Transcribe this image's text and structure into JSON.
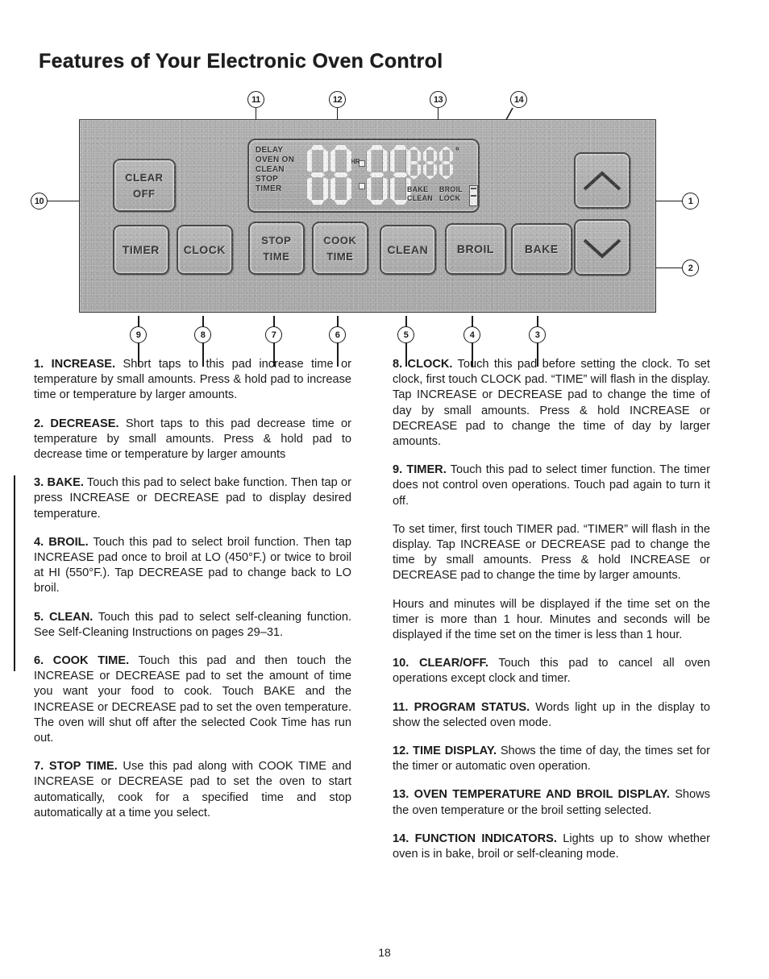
{
  "document": {
    "title": "Features of Your Electronic Oven Control",
    "page_number": "18"
  },
  "control_panel": {
    "display": {
      "program_status_labels": [
        "DELAY",
        "OVEN ON",
        "CLEAN",
        "STOP",
        "TIMER"
      ],
      "hr_marker": "HR",
      "degree_symbol": "°",
      "function_indicators": [
        [
          "BAKE",
          "CLEAN"
        ],
        [
          "BROIL",
          "LOCK"
        ]
      ]
    },
    "pads": {
      "clear_off_line1": "CLEAR",
      "clear_off_line2": "OFF",
      "timer": "TIMER",
      "clock": "CLOCK",
      "stop_time_line1": "STOP",
      "stop_time_line2": "TIME",
      "cook_time_line1": "COOK",
      "cook_time_line2": "TIME",
      "clean": "CLEAN",
      "broil": "BROIL",
      "bake": "BAKE",
      "increase_icon": "chevron-up-icon",
      "decrease_icon": "chevron-down-icon"
    },
    "callouts": {
      "c1": "1",
      "c2": "2",
      "c3": "3",
      "c4": "4",
      "c5": "5",
      "c6": "6",
      "c7": "7",
      "c8": "8",
      "c9": "9",
      "c10": "10",
      "c11": "11",
      "c12": "12",
      "c13": "13",
      "c14": "14"
    }
  },
  "left_column": {
    "p1_label": "1. INCREASE.",
    "p1_text": " Short taps to this pad increase time or temperature by small amounts. Press & hold pad to increase time or temperature by larger amounts.",
    "p2_label": "2. DECREASE.",
    "p2_text": " Short taps to this pad decrease time or temperature by small amounts. Press & hold pad to decrease time or temperature by larger amounts",
    "p3_label": "3. BAKE.",
    "p3_text": " Touch this pad to select bake function. Then tap or press INCREASE or DECREASE pad to display desired temperature.",
    "p4_label": "4. BROIL.",
    "p4_text": " Touch this pad to select broil function. Then tap INCREASE pad once to broil at LO (450°F.) or twice to broil at HI (550°F.). Tap DECREASE pad to change back to LO broil.",
    "p5_label": "5. CLEAN.",
    "p5_text": " Touch this pad to select self-cleaning function. See Self-Cleaning Instructions on pages 29–31.",
    "p6_label": "6. COOK TIME.",
    "p6_text": " Touch this pad and then touch the INCREASE or DECREASE pad to set the amount of time you want your food to cook. Touch BAKE and the INCREASE or DECREASE pad to set the oven temperature. The oven will shut off after the selected Cook Time has run out.",
    "p7_label": "7. STOP TIME.",
    "p7_text": " Use this pad along with COOK TIME and INCREASE or DECREASE pad to set the oven to start automatically, cook for a specified time and stop automatically at a time you select."
  },
  "right_column": {
    "p8_label": "8. CLOCK.",
    "p8_text": " Touch this pad before setting the clock. To set clock, first touch CLOCK pad. “TIME” will flash in the display. Tap INCREASE or DECREASE pad to change the time of day by small amounts. Press & hold INCREASE or DECREASE pad to change the time of day by larger amounts.",
    "p9_label": "9. TIMER.",
    "p9_text": " Touch this pad to select timer function. The timer does not control oven operations. Touch pad again to turn it off.",
    "p9b_text": "To set timer, first touch TIMER pad. “TIMER” will flash in the display. Tap INCREASE or DECREASE pad to change the time by small amounts. Press & hold INCREASE or DECREASE pad to change the time by larger amounts.",
    "p9c_text": "Hours and minutes will be displayed if the time set on the timer is more than 1 hour. Minutes and seconds will be displayed if the time set on the timer is less than 1 hour.",
    "p10_label": "10. CLEAR/OFF.",
    "p10_text": " Touch this pad to cancel all oven operations except clock and timer.",
    "p11_label": "11. PROGRAM STATUS.",
    "p11_text": " Words light up in the display to show the selected oven mode.",
    "p12_label": "12. TIME DISPLAY.",
    "p12_text": " Shows the time of day, the times set for the timer or automatic oven operation.",
    "p13_label": "13. OVEN TEMPERATURE AND BROIL DISPLAY.",
    "p13_text": " Shows the oven temperature or the broil setting selected.",
    "p14_label": "14. FUNCTION INDICATORS.",
    "p14_text": " Lights up to show whether oven is in bake, broil or self-cleaning mode."
  }
}
